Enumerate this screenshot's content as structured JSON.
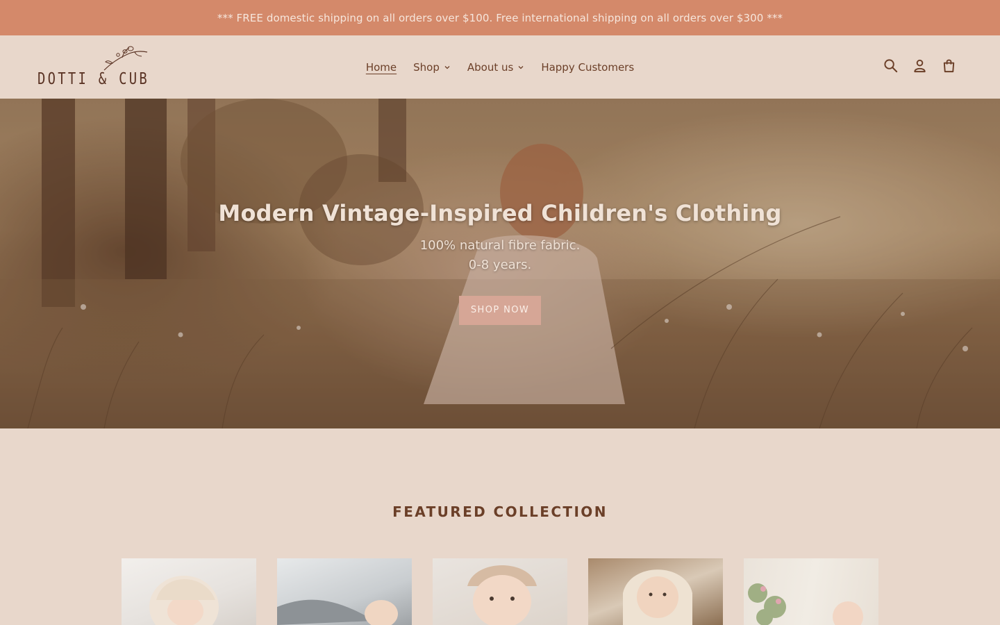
{
  "announcement": {
    "text": "*** FREE domestic shipping on all orders over $100. Free international shipping on all orders over $300 ***"
  },
  "header": {
    "logo_text": "DOTTI & CUB",
    "nav": [
      {
        "label": "Home",
        "active": true,
        "dropdown": false
      },
      {
        "label": "Shop",
        "active": false,
        "dropdown": true
      },
      {
        "label": "About us",
        "active": false,
        "dropdown": true
      },
      {
        "label": "Happy Customers",
        "active": false,
        "dropdown": false
      }
    ],
    "icons": [
      "search-icon",
      "account-icon",
      "cart-icon"
    ]
  },
  "hero": {
    "title": "Modern Vintage-Inspired Children's Clothing",
    "subtitle_line1": "100% natural fibre fabric.",
    "subtitle_line2": "0-8 years.",
    "button_label": "SHOP NOW"
  },
  "featured": {
    "title": "FEATURED COLLECTION",
    "products": [
      {
        "image": "sleeping-baby-bonnet"
      },
      {
        "image": "baby-grey-knit-blanket"
      },
      {
        "image": "baby-headwrap"
      },
      {
        "image": "baby-in-basket"
      },
      {
        "image": "baby-with-flowers"
      }
    ]
  },
  "colors": {
    "announcement_bg": "#d4896a",
    "page_bg": "#e8d7cb",
    "text": "#6b3f28",
    "button_bg": "#d6a696"
  }
}
